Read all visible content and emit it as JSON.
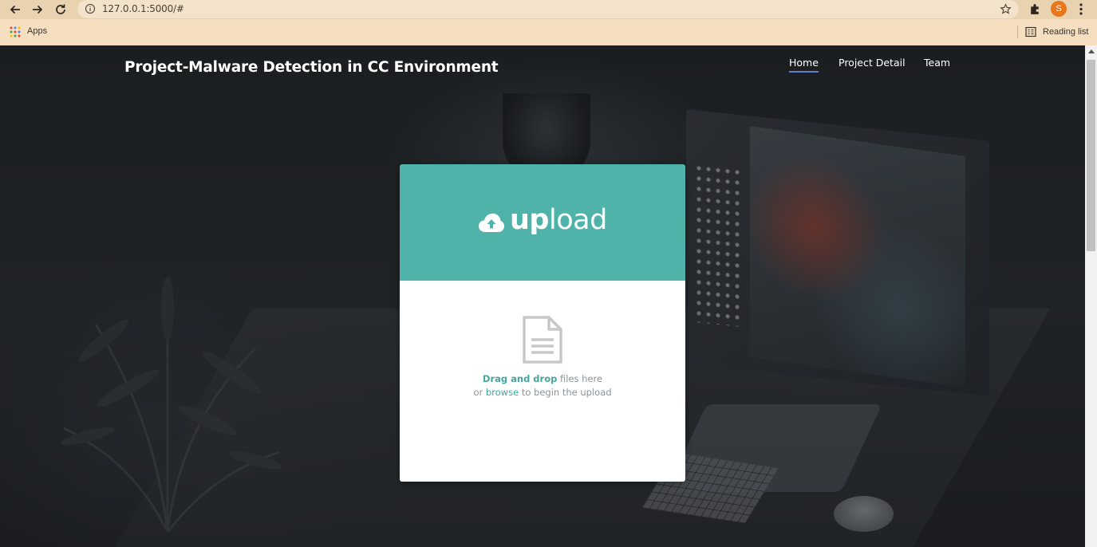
{
  "browser": {
    "url": "127.0.0.1:5000/#",
    "bookmarks": {
      "apps_label": "Apps",
      "reading_list_label": "Reading list"
    },
    "profile_initial": "S",
    "profile_color": "#e8761c"
  },
  "header": {
    "title": "Project-Malware Detection in CC Environment",
    "nav": [
      {
        "label": "Home",
        "active": true
      },
      {
        "label": "Project Detail",
        "active": false
      },
      {
        "label": "Team",
        "active": false
      }
    ]
  },
  "upload_card": {
    "title_bold": "up",
    "title_rest": "load",
    "accent_color": "#4fb3aa",
    "drop_line1_em": "Drag and drop",
    "drop_line1_rest": " files here",
    "drop_line2_pre": "or ",
    "drop_line2_link": "browse",
    "drop_line2_post": " to begin the upload",
    "icons": {
      "header": "cloud-upload-icon",
      "body": "document-icon"
    }
  }
}
